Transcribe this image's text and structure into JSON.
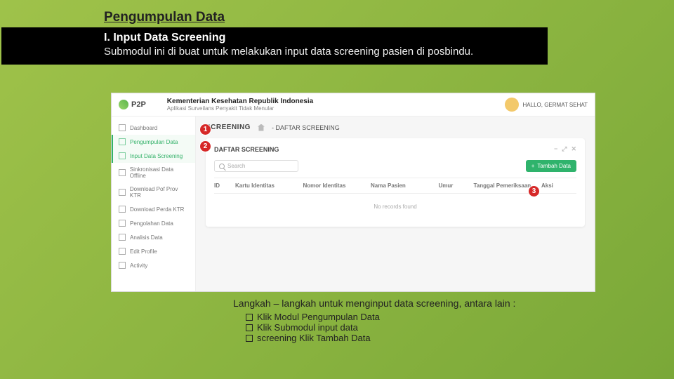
{
  "slide": {
    "title": "Pengumpulan Data",
    "section_label": "I. Input Data Screening",
    "section_body": "Submodul ini di buat untuk melakukan input data screening pasien di posbindu."
  },
  "screenshot": {
    "header": {
      "brand": "P2P",
      "title": "Kementerian Kesehatan Republik Indonesia",
      "subtitle": "Aplikasi Surveilans Penyakit Tidak Menular",
      "user_greeting": "HALLO, GERMAT SEHAT"
    },
    "sidebar": {
      "items": [
        {
          "label": "Dashboard",
          "active": false
        },
        {
          "label": "Pengumpulan Data",
          "active": true
        },
        {
          "label": "Input Data Screening",
          "active": true
        },
        {
          "label": "Sinkronisasi Data Offline",
          "active": false
        },
        {
          "label": "Download Pof Prov KTR",
          "active": false
        },
        {
          "label": "Download Perda KTR",
          "active": false
        },
        {
          "label": "Pengolahan Data",
          "active": false
        },
        {
          "label": "Analisis Data",
          "active": false
        },
        {
          "label": "Edit Profile",
          "active": false
        },
        {
          "label": "Activity",
          "active": false
        }
      ]
    },
    "main": {
      "page_label": "SCREENING",
      "breadcrumb": "- DAFTAR SCREENING",
      "card_title": "DAFTAR SCREENING",
      "search_placeholder": "Search",
      "add_button_label": "Tambah Data",
      "columns": [
        "ID",
        "Kartu Identitas",
        "Nomor Identitas",
        "Nama Pasien",
        "Umur",
        "Tanggal Pemeriksaan",
        "Aksi"
      ],
      "empty_text": "No records found"
    }
  },
  "callouts": {
    "c1": "1",
    "c2": "2",
    "c3": "3"
  },
  "steps": {
    "intro": "Langkah – langkah untuk menginput data screening, antara lain :",
    "lines": [
      "Klik Modul Pengumpulan Data",
      "Klik Submodul input data",
      "screening Klik Tambah Data"
    ]
  }
}
